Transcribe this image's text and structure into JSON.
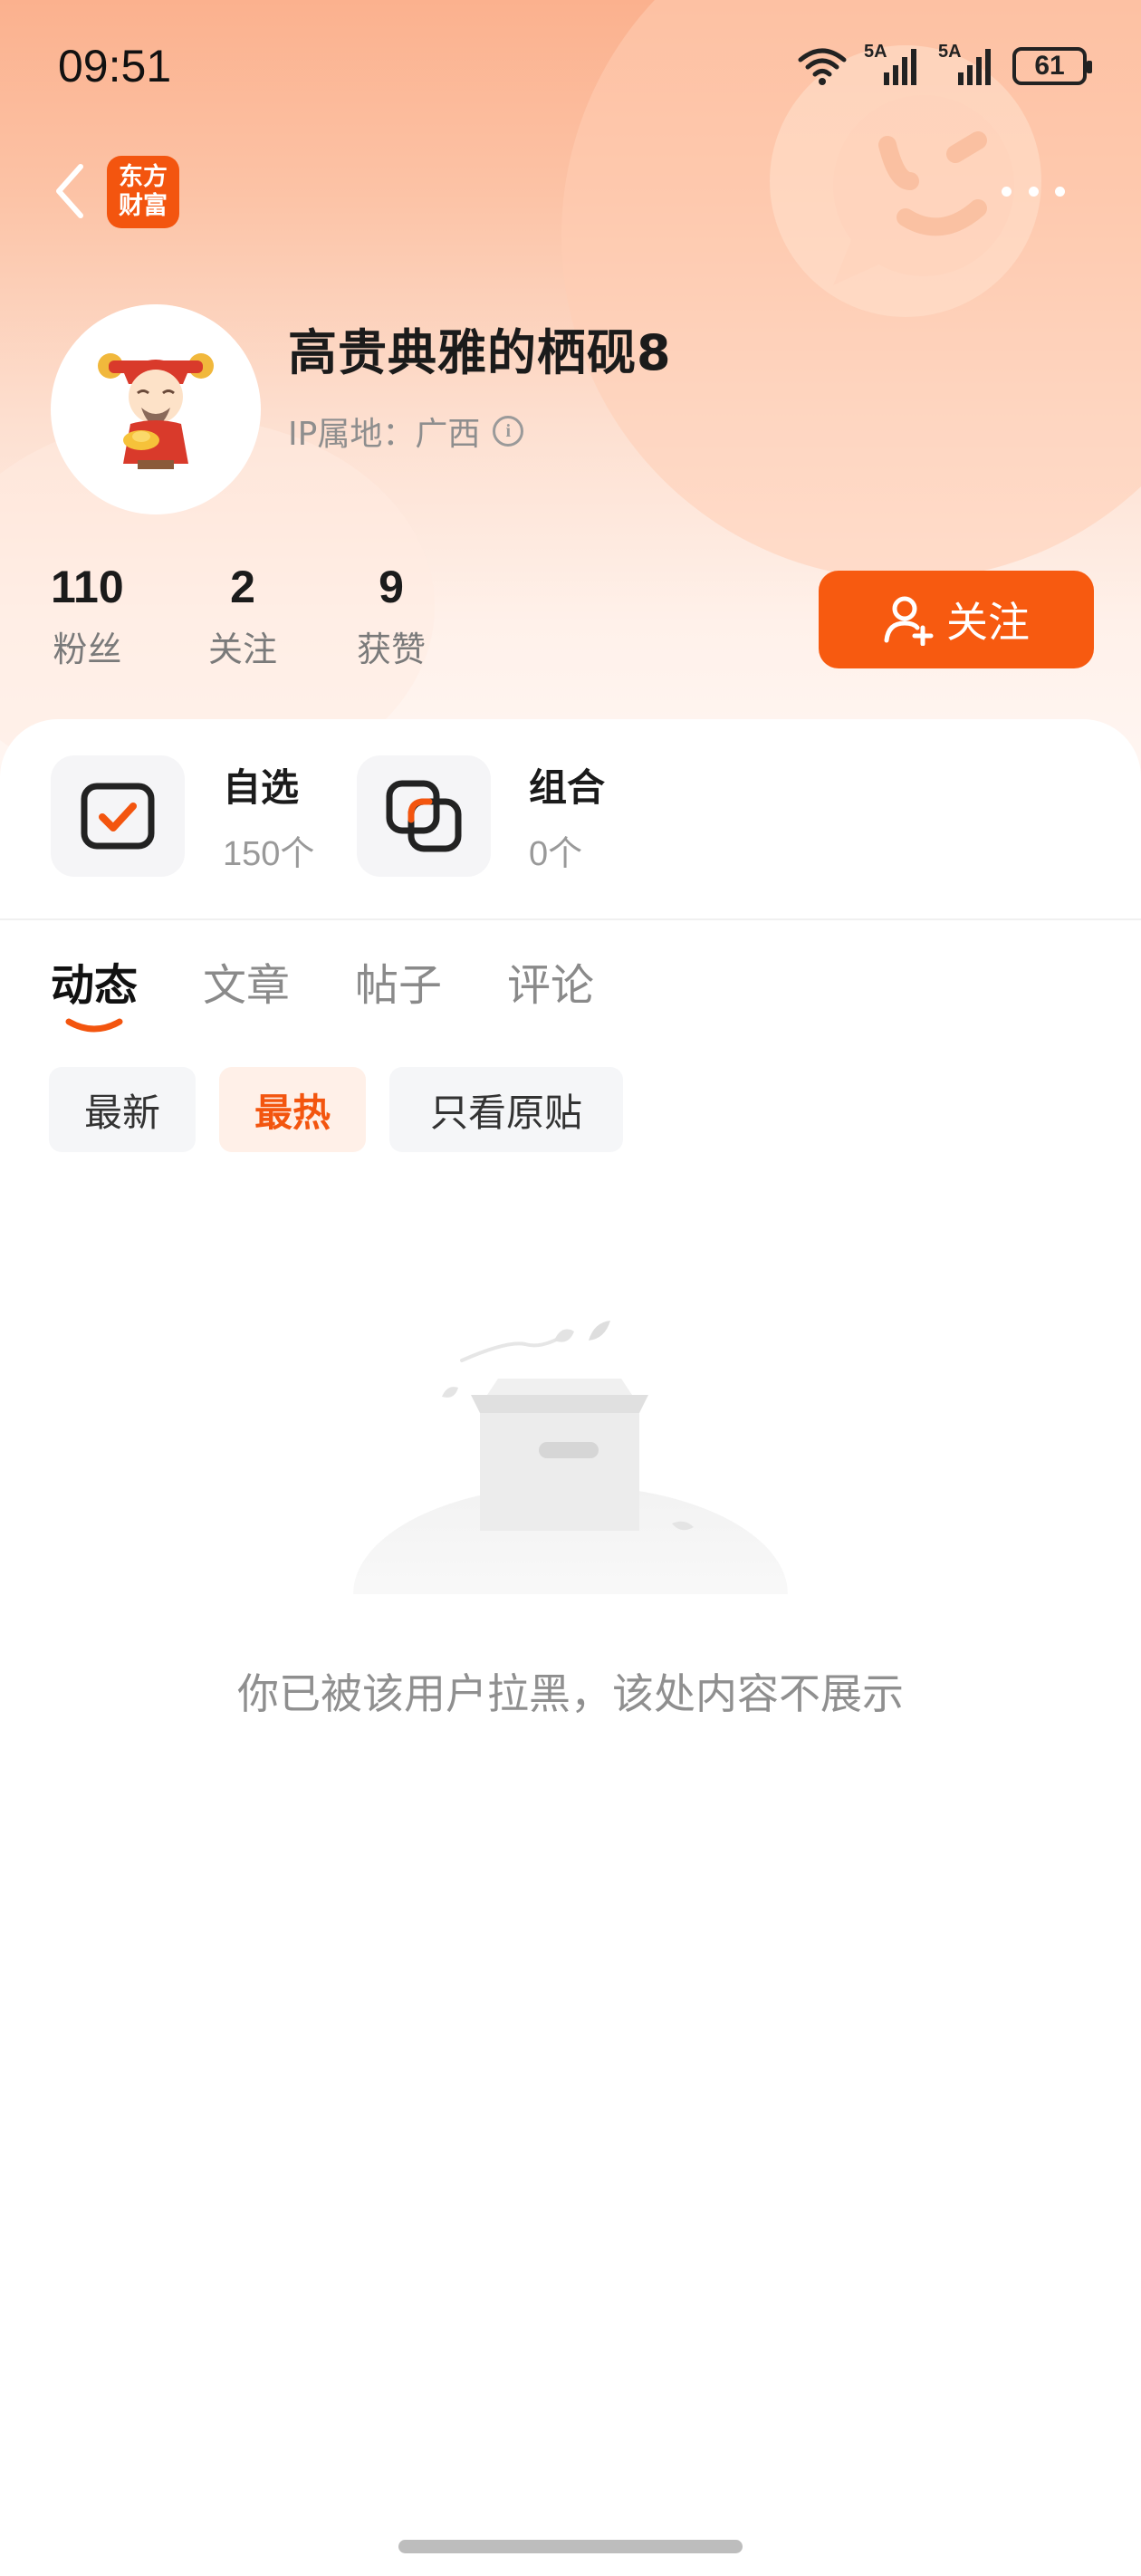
{
  "status_bar": {
    "time": "09:51",
    "signal1_label": "5A",
    "signal2_label": "5A",
    "battery": "61"
  },
  "nav": {
    "logo_line1": "东方",
    "logo_line2": "财富",
    "icons": [
      "back-icon",
      "more-icon"
    ]
  },
  "profile": {
    "username": "高贵典雅的栖砚8",
    "ip_location": "IP属地：广西",
    "stats": [
      {
        "value": "110",
        "label": "粉丝"
      },
      {
        "value": "2",
        "label": "关注"
      },
      {
        "value": "9",
        "label": "获赞"
      }
    ],
    "follow_label": "关注"
  },
  "assets": [
    {
      "title": "自选",
      "count": "150个",
      "icon": "watchlist-check-icon"
    },
    {
      "title": "组合",
      "count": "0个",
      "icon": "portfolio-icon"
    }
  ],
  "tabs": [
    {
      "label": "动态",
      "active": true
    },
    {
      "label": "文章",
      "active": false
    },
    {
      "label": "帖子",
      "active": false
    },
    {
      "label": "评论",
      "active": false
    }
  ],
  "filters": [
    {
      "label": "最新",
      "active": false
    },
    {
      "label": "最热",
      "active": true
    },
    {
      "label": "只看原贴",
      "active": false
    }
  ],
  "empty_state": {
    "message": "你已被该用户拉黑，该处内容不展示",
    "icon": "empty-box-illustration"
  },
  "colors": {
    "accent": "#f75a10",
    "logo": "#f3550f",
    "chip_active_bg": "#fff0e8"
  }
}
